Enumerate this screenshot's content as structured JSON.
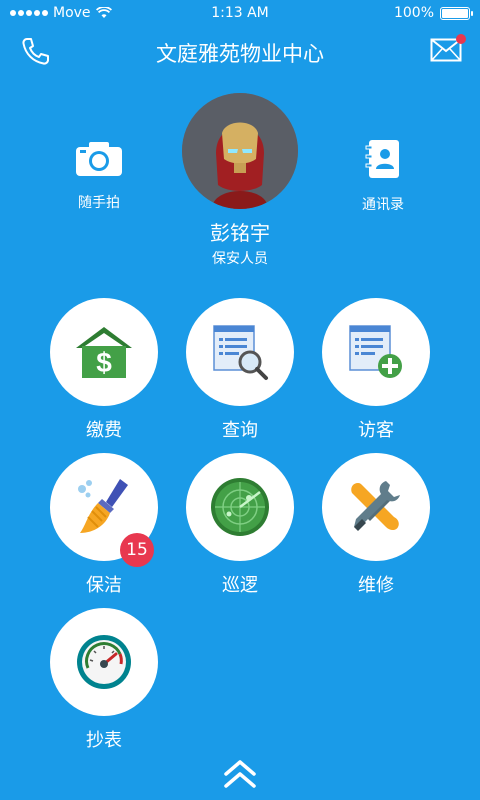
{
  "status_bar": {
    "carrier": "Move",
    "time": "1:13 AM",
    "battery": "100%"
  },
  "header": {
    "title": "文庭雅苑物业中心"
  },
  "profile": {
    "name": "彭铭宇",
    "role": "保安人员"
  },
  "quick_actions": {
    "camera_label": "随手拍",
    "contacts_label": "通讯录"
  },
  "tiles": {
    "payment": "缴费",
    "query": "查询",
    "visitor": "访客",
    "cleaning": "保洁",
    "cleaning_badge": "15",
    "patrol": "巡逻",
    "repair": "维修",
    "meter": "抄表"
  },
  "colors": {
    "background": "#1a9be8",
    "badge": "#e8384f"
  }
}
